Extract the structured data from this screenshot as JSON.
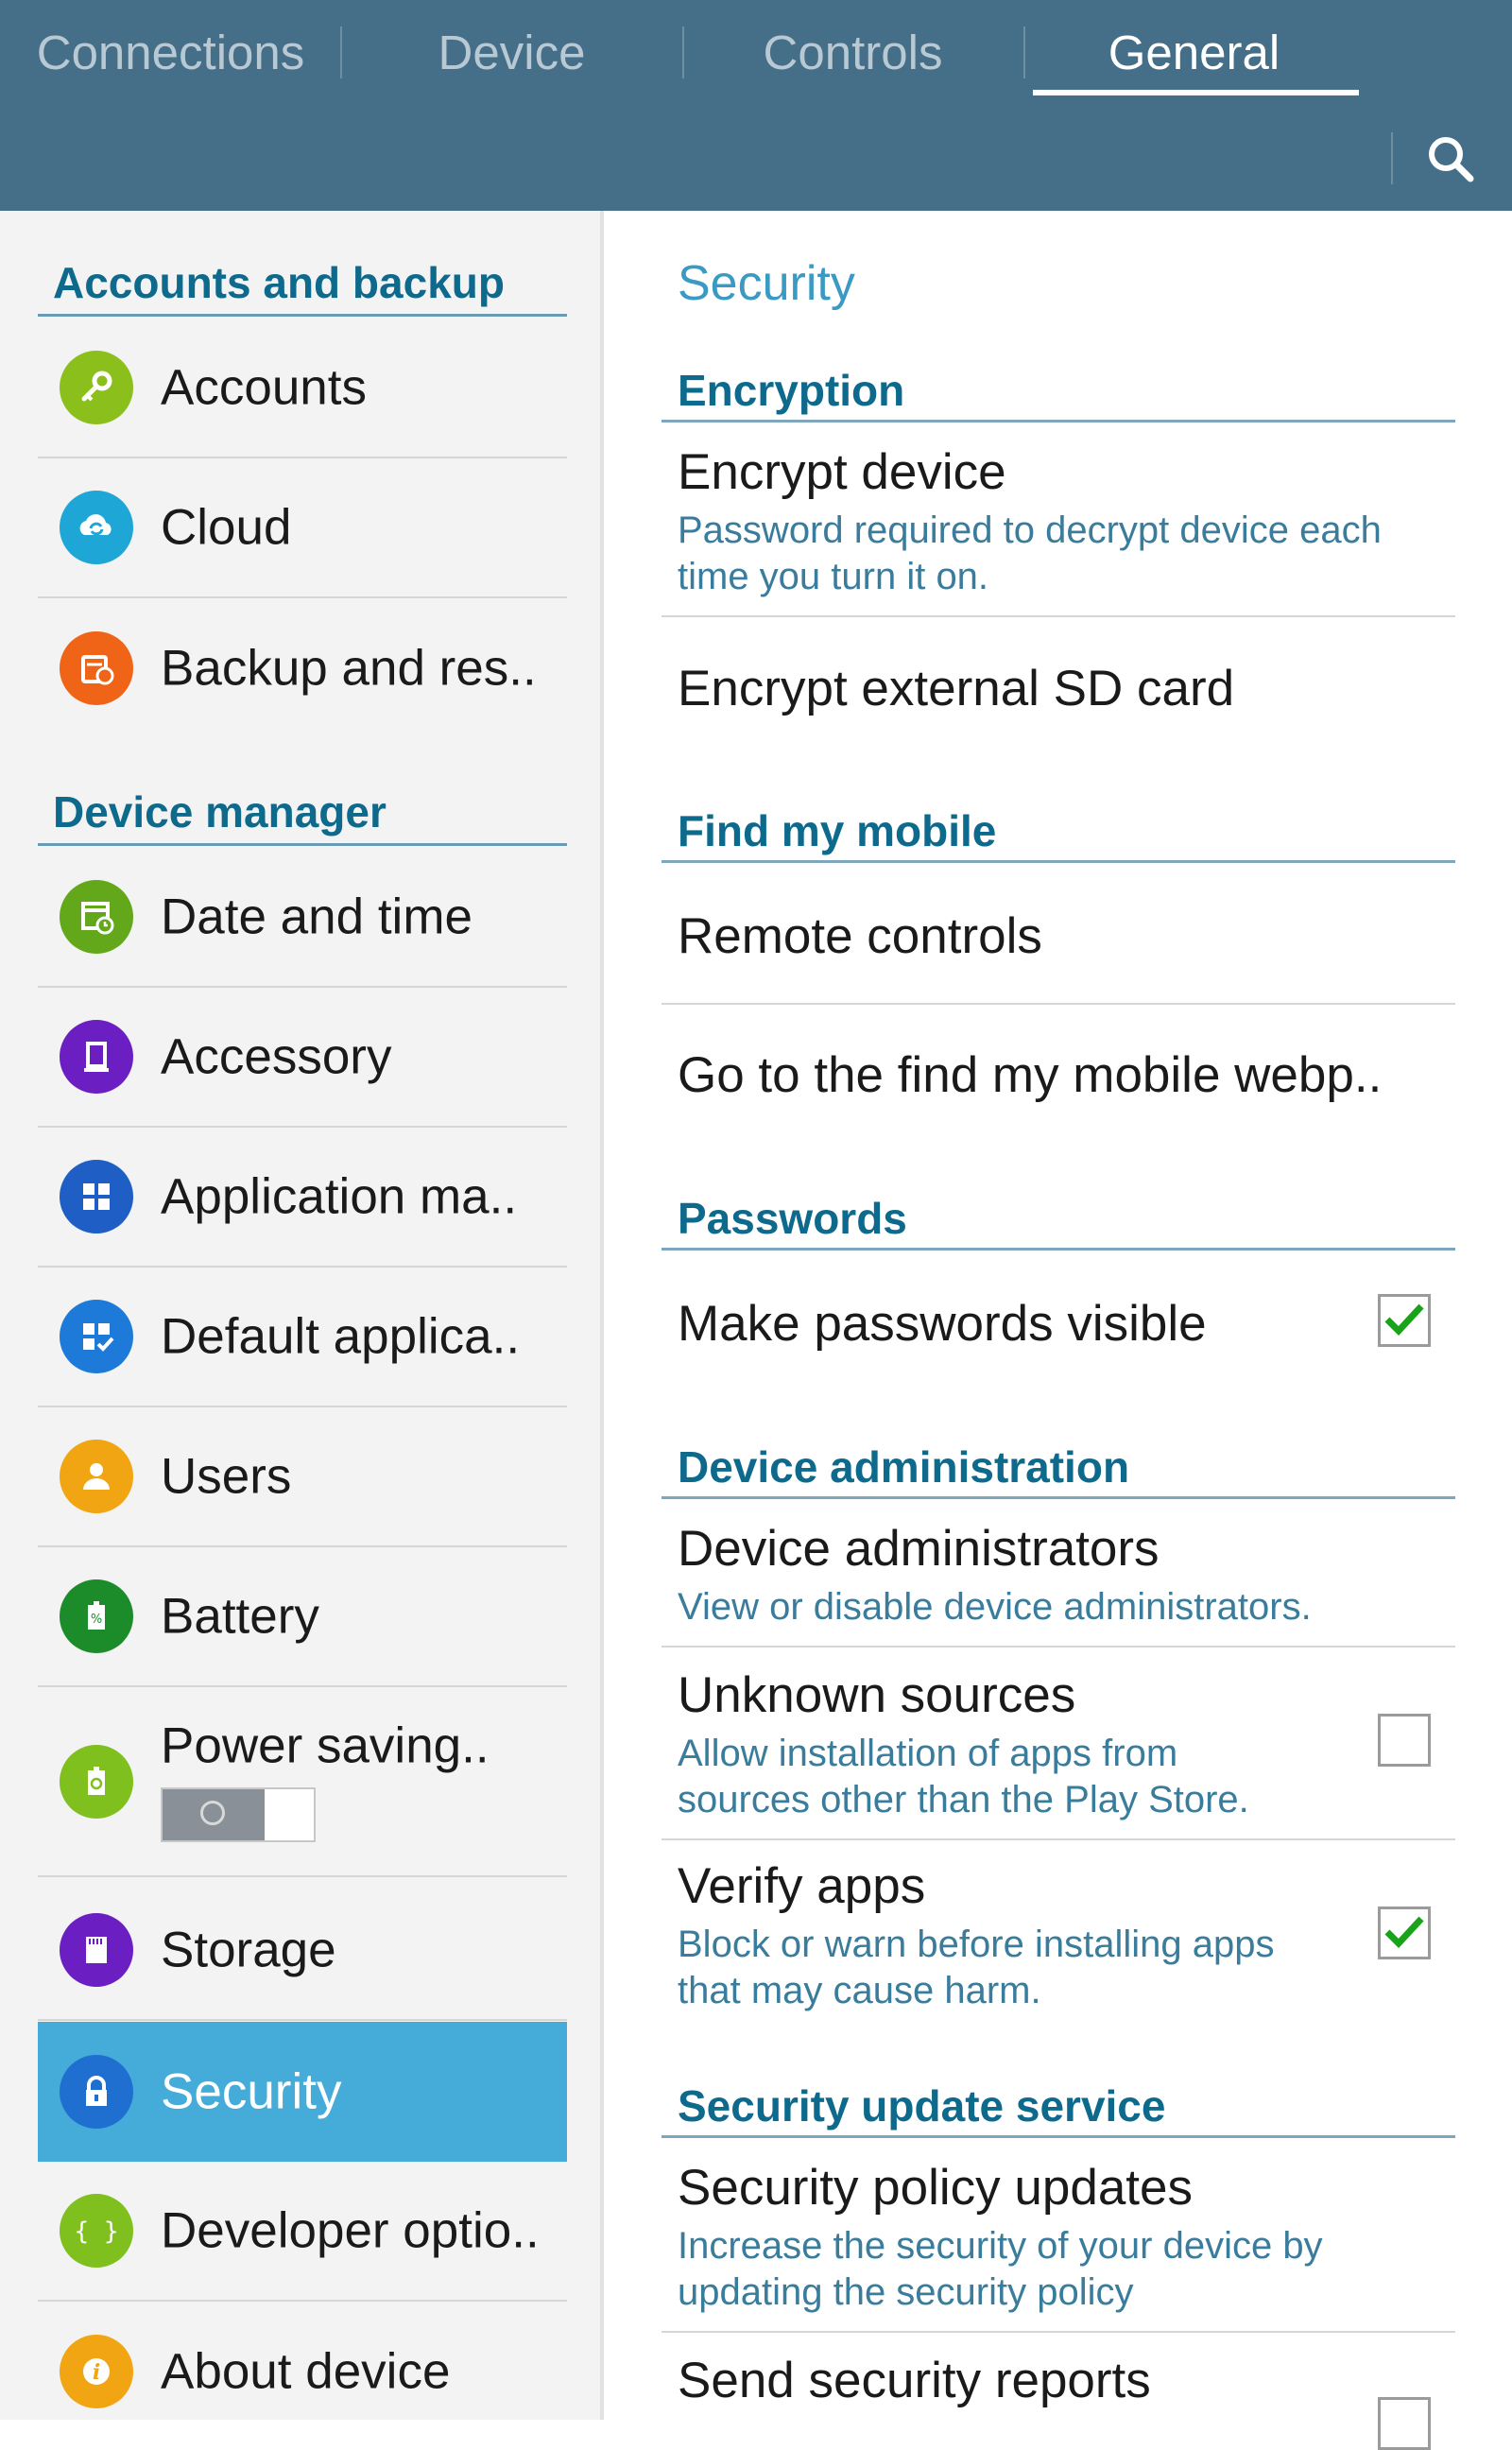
{
  "tabs": [
    {
      "label": "Connections"
    },
    {
      "label": "Device"
    },
    {
      "label": "Controls"
    },
    {
      "label": "General"
    }
  ],
  "sidebar": {
    "sections": [
      {
        "header": "Accounts and backup"
      },
      {
        "header": "Device manager"
      }
    ],
    "items": [
      {
        "label": "Accounts",
        "icon": "key-icon",
        "color": "#8bbf1c"
      },
      {
        "label": "Cloud",
        "icon": "cloud-icon",
        "color": "#1da6d6"
      },
      {
        "label": "Backup and res..",
        "icon": "backup-icon",
        "color": "#f06418"
      },
      {
        "label": "Date and time",
        "icon": "calendar-clock-icon",
        "color": "#63a81a"
      },
      {
        "label": "Accessory",
        "icon": "accessory-icon",
        "color": "#6b1fc2"
      },
      {
        "label": "Application ma..",
        "icon": "apps-grid-icon",
        "color": "#1f5fc5"
      },
      {
        "label": "Default applica..",
        "icon": "default-apps-icon",
        "color": "#1d7ad8"
      },
      {
        "label": "Users",
        "icon": "users-icon",
        "color": "#f1a512"
      },
      {
        "label": "Battery",
        "icon": "battery-icon",
        "color": "#1c8c2a"
      },
      {
        "label": "Power saving..",
        "icon": "power-saving-icon",
        "color": "#7fbf1e"
      },
      {
        "label": "Storage",
        "icon": "storage-icon",
        "color": "#6b1fc2"
      },
      {
        "label": "Security",
        "icon": "lock-icon",
        "color": "#1f6fd0"
      },
      {
        "label": "Developer optio..",
        "icon": "developer-icon",
        "color": "#7fbf1e"
      },
      {
        "label": "About device",
        "icon": "info-icon",
        "color": "#f1a512"
      }
    ],
    "power_saving_toggle": "off"
  },
  "main": {
    "title": "Security",
    "sections": {
      "encryption": "Encryption",
      "find_my_mobile": "Find my mobile",
      "passwords": "Passwords",
      "device_admin": "Device administration",
      "security_update": "Security update service"
    },
    "rows": {
      "encrypt_device": {
        "title": "Encrypt device",
        "desc": "Password required to decrypt device each time you turn it on."
      },
      "encrypt_sd": {
        "title": "Encrypt external SD card"
      },
      "remote_controls": {
        "title": "Remote controls"
      },
      "find_webpage": {
        "title": "Go to the find my mobile webp.."
      },
      "passwords_visible": {
        "title": "Make passwords visible",
        "checked": true
      },
      "device_admins": {
        "title": "Device administrators",
        "desc": "View or disable device administrators."
      },
      "unknown_sources": {
        "title": "Unknown sources",
        "desc": "Allow installation of apps from sources other than the Play Store.",
        "checked": false
      },
      "verify_apps": {
        "title": "Verify apps",
        "desc": "Block or warn before installing apps that may cause harm.",
        "checked": true
      },
      "policy_updates": {
        "title": "Security policy updates",
        "desc": "Increase the security of your device by updating the security policy"
      },
      "send_reports": {
        "title": "Send security reports",
        "checked": false
      }
    }
  },
  "colors": {
    "topbar": "#456e88",
    "accent": "#0e6a8c",
    "selected": "#45abd9",
    "check": "#1aa31a"
  }
}
